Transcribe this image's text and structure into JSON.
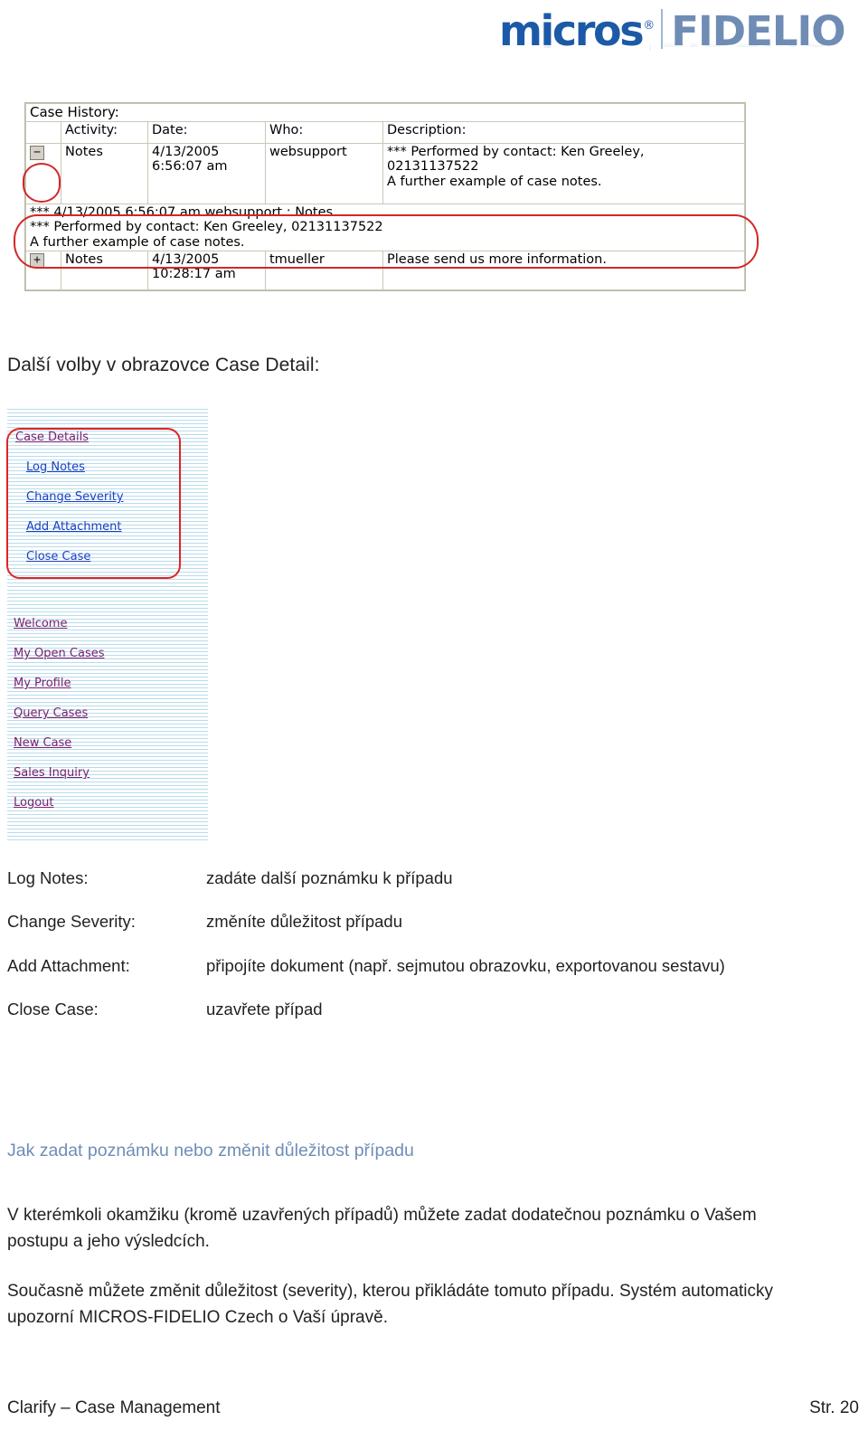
{
  "logo": {
    "brand_primary": "micros",
    "registered_mark": "®",
    "brand_secondary": "FIDELIO",
    "color_primary": "#1c5aa8",
    "color_secondary": "#6f8cb4"
  },
  "case_history": {
    "title": "Case History:",
    "columns": [
      "",
      "Activity:",
      "Date:",
      "Who:",
      "Description:"
    ],
    "rows": [
      {
        "expander": "−",
        "expander_state": "expanded",
        "activity": "Notes",
        "date_line1": "4/13/2005",
        "date_line2": "6:56:07 am",
        "who": "websupport",
        "desc_line1": "*** Performed by contact: Ken Greeley,",
        "desc_line2": "02131137522",
        "desc_line3": "A further example of case notes."
      }
    ],
    "expanded_note": {
      "line1": "*** 4/13/2005 6:56:07 am websupport : Notes",
      "line2": "*** Performed by contact: Ken Greeley, 02131137522",
      "line3": "A further example of case notes."
    },
    "last_row": {
      "expander": "+",
      "expander_state": "collapsed",
      "activity": "Notes",
      "date_line1": "4/13/2005",
      "date_line2": "10:28:17 am",
      "who": "tmueller",
      "desc": "Please send us more information."
    },
    "annotation_color": "#d42727"
  },
  "section_heading": "Další volby v obrazovce Case Detail:",
  "menu": {
    "case_group": [
      {
        "label": "Case Details",
        "level": "top"
      },
      {
        "label": "Log Notes",
        "level": "sub"
      },
      {
        "label": "Change Severity",
        "level": "sub"
      },
      {
        "label": "Add Attachment",
        "level": "sub"
      },
      {
        "label": "Close Case",
        "level": "sub"
      }
    ],
    "nav_group": [
      {
        "label": "Welcome"
      },
      {
        "label": "My Open Cases"
      },
      {
        "label": "My Profile"
      },
      {
        "label": "Query Cases"
      },
      {
        "label": "New Case"
      },
      {
        "label": "Sales Inquiry"
      },
      {
        "label": "Logout"
      }
    ],
    "link_color_visited": "#7a1f6e",
    "link_color_active": "#1b3fc4",
    "annotation_color": "#e02424"
  },
  "definitions": [
    {
      "term": "Log Notes:",
      "desc": "zadáte další poznámku k případu"
    },
    {
      "term": "Change Severity:",
      "desc": "změníte důležitost případu"
    },
    {
      "term": "Add Attachment:",
      "desc": "připojíte dokument (např. sejmutou obrazovku, exportovanou sestavu)"
    },
    {
      "term": "Close Case:",
      "desc": "uzavřete případ"
    }
  ],
  "blue_heading": {
    "text": "Jak zadat poznámku nebo změnit důležitost případu",
    "color": "#6f8db8"
  },
  "paragraphs": {
    "p1": "V kterémkoli okamžiku (kromě uzavřených případů) můžete zadat dodatečnou poznámku o Vašem postupu a jeho výsledcích.",
    "p2": "Současně můžete změnit důležitost (severity), kterou přikládáte tomuto případu. Systém automaticky upozorní MICROS-FIDELIO Czech  o Vaší úpravě."
  },
  "footer": {
    "left": "Clarify – Case Management",
    "right": "Str. 20"
  }
}
